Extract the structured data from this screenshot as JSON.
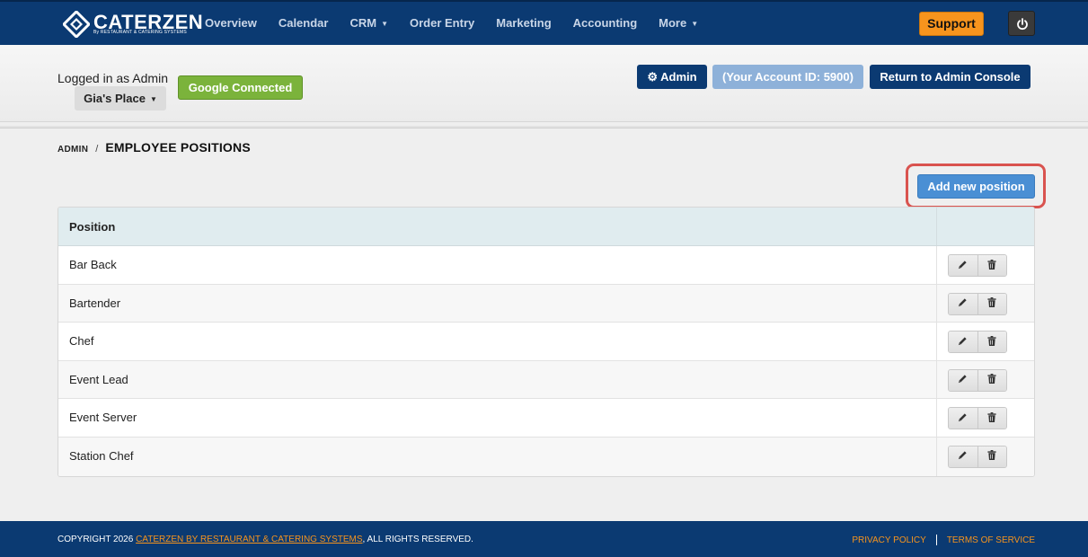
{
  "brand": {
    "name": "CATERZEN",
    "tagline": "By RESTAURANT & CATERING SYSTEMS",
    "color_primary": "#0b3a72",
    "color_accent": "#f7941d"
  },
  "nav": {
    "items": [
      {
        "label": "Overview",
        "has_caret": false
      },
      {
        "label": "Calendar",
        "has_caret": false
      },
      {
        "label": "CRM",
        "has_caret": true
      },
      {
        "label": "Order Entry",
        "has_caret": false
      },
      {
        "label": "Marketing",
        "has_caret": false
      },
      {
        "label": "Accounting",
        "has_caret": false
      },
      {
        "label": "More",
        "has_caret": true
      }
    ],
    "support_label": "Support",
    "power_icon": "power-icon"
  },
  "account": {
    "logged_in_text": "Logged in as Admin",
    "place_label": "Gia's Place",
    "google_label": "Google Connected",
    "admin_label": "Admin",
    "account_id_label": "(Your Account ID: 5900)",
    "return_label": "Return to Admin Console"
  },
  "breadcrumb": {
    "parent": "ADMIN",
    "separator": "/",
    "current": "EMPLOYEE POSITIONS"
  },
  "actions": {
    "add_label": "Add new position"
  },
  "table": {
    "header": "Position",
    "rows": [
      "Bar Back",
      "Bartender",
      "Chef",
      "Event Lead",
      "Event Server",
      "Station Chef"
    ]
  },
  "footer": {
    "copyright_prefix": "COPYRIGHT 2026 ",
    "copyright_link": "CATERZEN BY RESTAURANT & CATERING SYSTEMS",
    "copyright_suffix": ", ALL RIGHTS RESERVED.",
    "privacy": "PRIVACY POLICY",
    "terms": "TERMS OF SERVICE"
  }
}
